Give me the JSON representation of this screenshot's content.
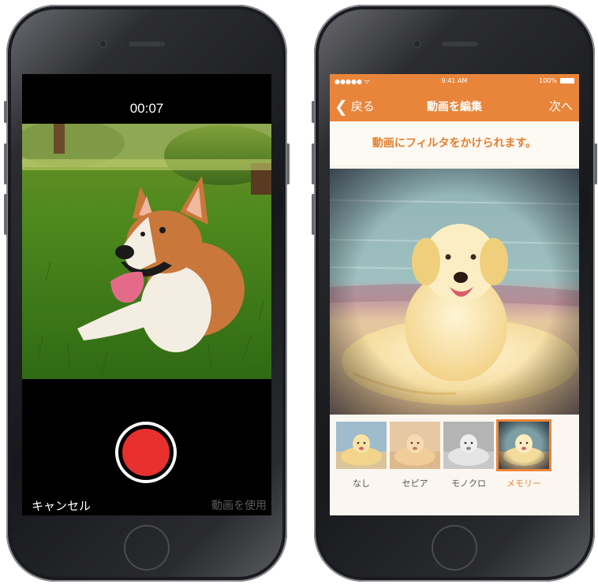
{
  "left_phone": {
    "timer": "00:07",
    "cancel_label": "キャンセル",
    "use_label": "動画を使用",
    "record_button_color": "#e8302e"
  },
  "right_phone": {
    "status": {
      "time": "9:41 AM",
      "battery": "100%",
      "signal": "●●●●● ᯤ"
    },
    "nav": {
      "back_label": "戻る",
      "title": "動画を編集",
      "next_label": "次へ"
    },
    "subtitle": "動画にフィルタをかけられます。",
    "filters": [
      {
        "label": "なし",
        "selected": false
      },
      {
        "label": "セピア",
        "selected": false
      },
      {
        "label": "モノクロ",
        "selected": false
      },
      {
        "label": "メモリー",
        "selected": true
      }
    ],
    "accent_color": "#e9853a"
  }
}
